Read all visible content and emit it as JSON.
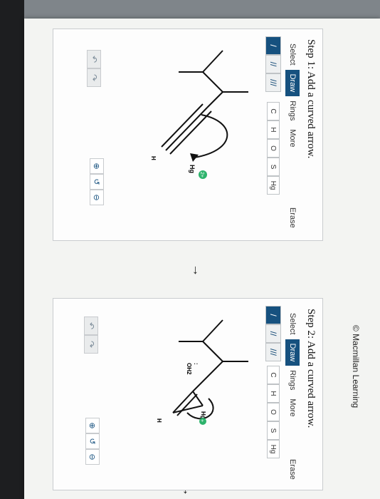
{
  "copyright": "© Macmillan Learning",
  "step1": {
    "title": "Step 1: Add a curved arrow.",
    "tabs": [
      "Select",
      "Draw",
      "Rings",
      "More"
    ],
    "active_tab": "Draw",
    "erase": "Erase",
    "bonds": [
      "/",
      "//",
      "///"
    ],
    "atoms": [
      "C",
      "H",
      "O",
      "S",
      "Hg"
    ],
    "molecule_labels": {
      "hg": "Hg",
      "hg_charge": "2+",
      "h": "H"
    }
  },
  "step2": {
    "title": "Step 2: Add a curved arrow.",
    "tabs": [
      "Select",
      "Draw",
      "Rings",
      "More"
    ],
    "active_tab": "Draw",
    "erase": "Erase",
    "bonds": [
      "/",
      "//",
      "///"
    ],
    "atoms": [
      "C",
      "H",
      "O",
      "S",
      "Hg"
    ],
    "molecule_labels": {
      "oh2": "OH2",
      "lone_pair": ":",
      "hg": "Hg",
      "hg_charge": "+",
      "h": "H"
    }
  },
  "colors": {
    "active_tab": "#16517f",
    "charge_badge": "#2db36c"
  },
  "icons": [
    "undo-icon",
    "redo-icon",
    "zoom-in-icon",
    "zoom-reset-icon",
    "zoom-out-icon",
    "arrow-down-icon"
  ]
}
